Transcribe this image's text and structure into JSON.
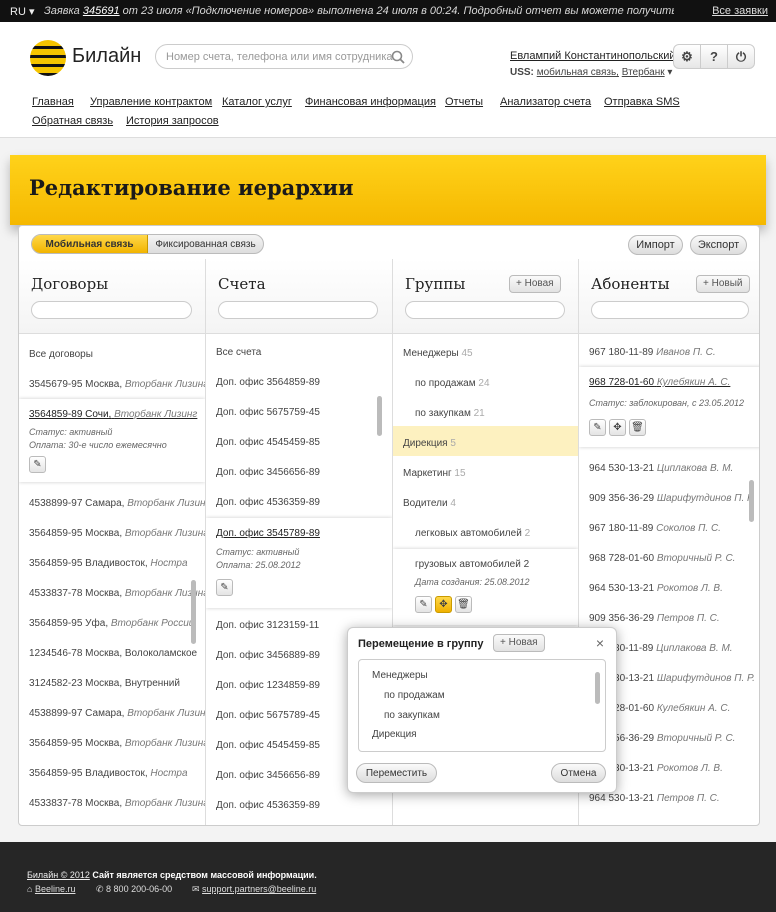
{
  "topbar": {
    "lang": "RU",
    "notice_prefix": "Заявка",
    "notice_num": "345691",
    "notice_rest": "от 23 июля «Подключение номеров» выполнена 24 июля в 00:24. Подробный отчет вы можете получить по телефону",
    "all_requests": "Все заявки"
  },
  "header": {
    "logo_text": "Билайн",
    "search_placeholder": "Номер счета, телефона или имя сотрудника",
    "user_name": "Евлампий Константинопольский",
    "user_company_prefix": "USS:",
    "user_company": "мобильная связь,",
    "user_branch": "Втербанк",
    "btn_help": "?"
  },
  "nav": [
    "Главная",
    "Управление контрактом",
    "Каталог услуг",
    "Финансовая информация",
    "Отчеты",
    "Анализатор счета",
    "Отправка SMS",
    "Обратная связь",
    "История запросов"
  ],
  "page_title": "Редактирование иерархии",
  "tabs": {
    "mobile": "Мобильная связь",
    "fixed": "Фиксированная связь"
  },
  "actions": {
    "import": "Импорт",
    "export": "Экспорт"
  },
  "contracts": {
    "title": "Договоры",
    "all": "Все договоры",
    "first": "3545679-95",
    "first_city": "Москва,",
    "first_company": "Вторбанк Лизинг",
    "selected": {
      "num": "3564859-89",
      "city": "Сочи,",
      "company": "Вторбанк Лизинг",
      "status": "Статус: активный",
      "payment": "Оплата: 30-е число ежемесячно"
    },
    "rows": [
      {
        "num": "4538899-97",
        "city": "Самара,",
        "company": "Вторбанк Лизинг"
      },
      {
        "num": "3564859-95",
        "city": "Москва,",
        "company": "Вторбанк Лизинг"
      },
      {
        "num": "3564859-95",
        "city": "Владивосток,",
        "company": "Нострa"
      },
      {
        "num": "4533837-78",
        "city": "Москва,",
        "company": "Вторбанк Лизинг"
      },
      {
        "num": "3564859-95",
        "city": "Уфа,",
        "company": "Вторбанк России"
      },
      {
        "num": "1234546-78",
        "city": "Москва, Волоколамское",
        "company": ""
      },
      {
        "num": "3124582-23",
        "city": "Москва, Внутренний",
        "company": ""
      },
      {
        "num": "4538899-97",
        "city": "Самара,",
        "company": "Вторбанк Лизинг"
      },
      {
        "num": "3564859-95",
        "city": "Москва,",
        "company": "Вторбанк Лизинг"
      },
      {
        "num": "3564859-95",
        "city": "Владивосток,",
        "company": "Нострa"
      },
      {
        "num": "4533837-78",
        "city": "Москва,",
        "company": "Вторбанк Лизинг"
      }
    ]
  },
  "accounts": {
    "title": "Счета",
    "all": "Все счета",
    "top": [
      "Доп. офис 3564859-89",
      "Доп. офис 5675759-45",
      "Доп. офис 4545459-85",
      "Доп. офис 3456656-89",
      "Доп. офис 4536359-89"
    ],
    "selected": {
      "name": "Доп. офис 3545789-89",
      "status": "Статус: активный",
      "date": "Оплата: 25.08.2012"
    },
    "bottom": [
      "Доп. офис 3123159-11",
      "Доп. офис 3456889-89",
      "Доп. офис 1234859-89",
      "Доп. офис 5675789-45",
      "Доп. офис 4545459-85",
      "Доп. офис 3456656-89",
      "Доп. офис 4536359-89"
    ]
  },
  "groups": {
    "title": "Группы",
    "new": "Новая",
    "items": [
      {
        "name": "Менеджеры",
        "count": "45"
      },
      {
        "name": "по продажам",
        "count": "24"
      },
      {
        "name": "по закупкам",
        "count": "21"
      },
      {
        "name": "Дирекция",
        "count": "5"
      },
      {
        "name": "Маркетинг",
        "count": "15"
      },
      {
        "name": "Водители",
        "count": "4"
      },
      {
        "name": "легковых автомобилей",
        "count": "2"
      }
    ],
    "selected": {
      "name": "грузовых автомобилей",
      "count": "2",
      "date": "Дата создания: 25.08.2012"
    }
  },
  "subscribers": {
    "title": "Абоненты",
    "new": "Новый",
    "first": {
      "num": "967 180-11-89",
      "name": "Иванов П. С."
    },
    "selected": {
      "num": "968 728-01-60",
      "name": "Кулебякин А. С.",
      "status": "Статус: заблокирован, с 23.05.2012"
    },
    "rows": [
      {
        "num": "964 530-13-21",
        "name": "Циплакова В. М."
      },
      {
        "num": "909 356-36-29",
        "name": "Шарифутдинов П. Р."
      },
      {
        "num": "967 180-11-89",
        "name": "Соколов П. С."
      },
      {
        "num": "968 728-01-60",
        "name": "Вторичный Р. С."
      },
      {
        "num": "964 530-13-21",
        "name": "Рокотов Л. В."
      },
      {
        "num": "909 356-36-29",
        "name": "Петров П. С."
      },
      {
        "num": "967 180-11-89",
        "name": "Циплакова В. М."
      },
      {
        "num": "964 530-13-21",
        "name": "Шарифутдинов П. Р."
      },
      {
        "num": "968 728-01-60",
        "name": "Кулебякин А. С."
      },
      {
        "num": "909 356-36-29",
        "name": "Вторичный Р. С."
      },
      {
        "num": "964 530-13-21",
        "name": "Рокотов Л. В."
      },
      {
        "num": "964 530-13-21",
        "name": "Петров П. С."
      }
    ]
  },
  "popup": {
    "title": "Перемещение в группу",
    "new": "Новая",
    "items": [
      "Менеджеры",
      "по продажам",
      "по закупкам",
      "Дирекция"
    ],
    "move": "Переместить",
    "cancel": "Отмена"
  },
  "footer": {
    "copyright": "Билайн © 2012",
    "media": "Сайт является средством массовой информации.",
    "site": "Beeline.ru",
    "phone": "8 800 200-06-00",
    "email": "support.partners@beeline.ru"
  }
}
